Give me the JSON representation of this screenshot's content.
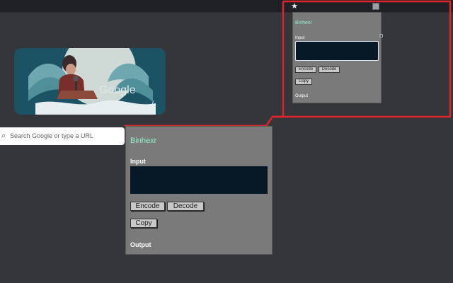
{
  "browser": {
    "star_icon": "star-icon",
    "extension_icon": "extension-icon"
  },
  "newtab": {
    "search_placeholder": "Search Google or type a URL",
    "doodle_word": "Google",
    "share_icon": "share-icon"
  },
  "popup_small": {
    "title": "Binhexr",
    "input_label": "Input",
    "encode_label": "Encode",
    "decode_label": "Decode",
    "copy_label": "Copy",
    "output_label": "Output"
  },
  "popup_large": {
    "title": "Binhexr",
    "input_label": "Input",
    "encode_label": "Encode",
    "decode_label": "Decode",
    "copy_label": "Copy",
    "output_label": "Output"
  },
  "colors": {
    "background": "#35363a",
    "popup_bg": "#7a7a7a",
    "title_accent": "#8ff0c8",
    "textarea_bg": "#071826",
    "highlight": "#e0242b"
  }
}
